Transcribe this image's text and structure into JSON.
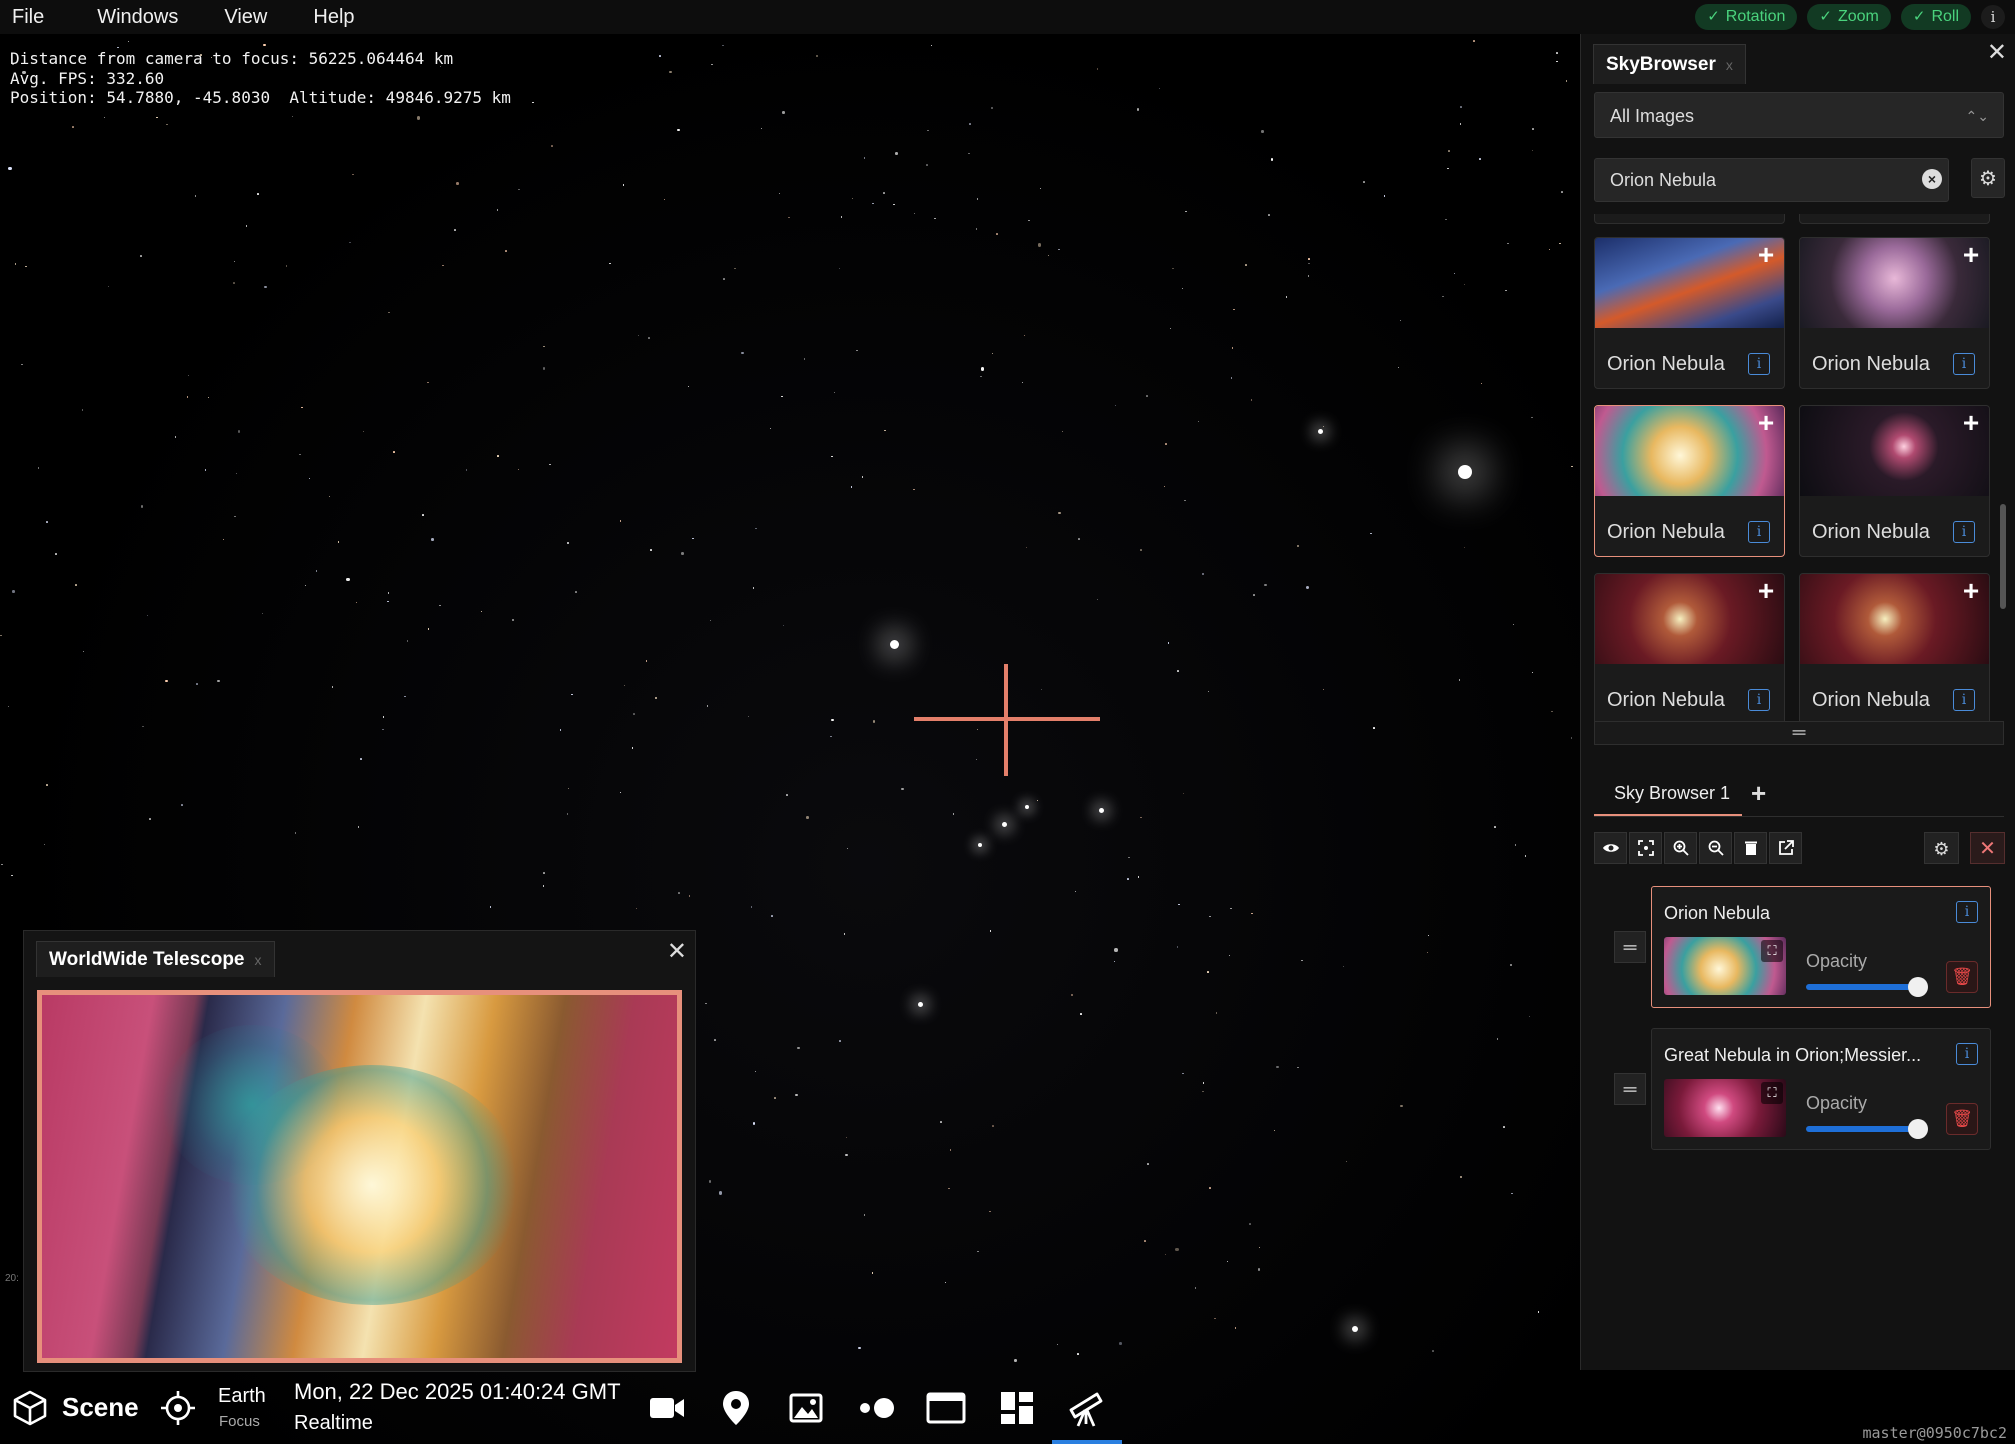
{
  "menu": {
    "items": [
      "File",
      "Windows",
      "View",
      "Help"
    ]
  },
  "toggles": [
    {
      "label": "Rotation",
      "check": "✓"
    },
    {
      "label": "Zoom",
      "check": "✓"
    },
    {
      "label": "Roll",
      "check": "✓"
    }
  ],
  "info_icon": "i",
  "debug": {
    "line1": "Distance from camera to focus: 56225.064464 km",
    "line2": "Avg. FPS: 332.60",
    "line3": "Position: 54.7880, -45.8030  Altitude: 49846.9275 km"
  },
  "wwt": {
    "title": "WorldWide Telescope",
    "tab_close": "x",
    "close": "✕"
  },
  "bottom": {
    "scene": "Scene",
    "focus_name": "Earth",
    "focus_sub": "Focus",
    "date": "Mon, 22 Dec 2025 01:40:24 GMT",
    "time_mode": "Realtime",
    "version": "master@0950c7bc2",
    "side_text": "20:",
    "icons": [
      "scene-cube-icon",
      "focus-target-icon",
      "camera-icon",
      "location-pin-icon",
      "image-icon",
      "toggle-icon",
      "window-icon",
      "dashboard-icon",
      "telescope-icon"
    ]
  },
  "skybrowser": {
    "title": "SkyBrowser",
    "tab_close": "x",
    "close": "✕",
    "filter": "All Images",
    "search_value": "Orion Nebula",
    "cards": [
      {
        "name": "Orion Nebula",
        "plus": "+",
        "info": "i"
      },
      {
        "name": "Orion Nebula",
        "plus": "+",
        "info": "i"
      },
      {
        "name": "Orion Nebula",
        "plus": "+",
        "info": "i"
      },
      {
        "name": "Orion Nebula",
        "plus": "+",
        "info": "i"
      },
      {
        "name": "Orion Nebula",
        "plus": "+",
        "info": "i"
      },
      {
        "name": "Orion Nebula",
        "plus": "+",
        "info": "i"
      }
    ],
    "divider": "═",
    "browser_tab": "Sky Browser 1",
    "add_tab": "+",
    "layers": [
      {
        "name": "Orion Nebula",
        "info": "i",
        "opacity_label": "Opacity",
        "opacity": 1.0,
        "handle": "═"
      },
      {
        "name": "Great Nebula in Orion;Messier...",
        "info": "i",
        "opacity_label": "Opacity",
        "opacity": 1.0,
        "handle": "═"
      }
    ]
  },
  "colors": {
    "accent": "#e7907c",
    "toggle_green": "#4ad37d",
    "info_blue": "#4a8bd8",
    "slider_blue": "#1e6fd8",
    "delete_red": "#e64848"
  }
}
